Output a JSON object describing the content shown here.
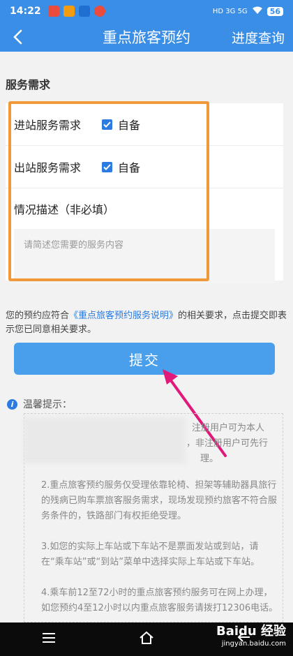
{
  "status_bar": {
    "time": "14:22",
    "network": "HD 3G 5G",
    "battery": "56"
  },
  "header": {
    "title": "重点旅客预约",
    "progress_link": "进度查询"
  },
  "service": {
    "section_title": "服务需求",
    "rows": [
      {
        "label": "进站服务需求",
        "option": "自备",
        "checked": true
      },
      {
        "label": "出站服务需求",
        "option": "自备",
        "checked": true
      }
    ],
    "description_label": "情况描述（非必填）",
    "description_placeholder": "请简述您需要的服务内容"
  },
  "agreement": {
    "prefix": "您的预约应符合",
    "link": "《重点旅客预约服务说明》",
    "suffix": "的相关要求，点击提交即表示您已同意相关要求。"
  },
  "submit_label": "提交",
  "tips": {
    "title": "温馨提示：",
    "partial_lines": [
      "注册用户可为本人",
      "，非注册用户可先行",
      "理。"
    ],
    "item2": "2.重点旅客预约服务仅受理依靠轮椅、担架等辅助器具旅行的残病已购车票旅客服务需求，现场发现预约旅客不符合服务条件的，铁路部门有权拒绝受理。",
    "item3": "3.如您的实际上车站或下车站不是票面发站或到站，请在“乘车站”或“到站”菜单中选择实际上车站或下车站。",
    "item4": "4.乘车前12至72小时的重点旅客预约服务可在网上办理，如您预约4至12小时以内重点旅客服务请拨打12306电话。"
  },
  "watermark": {
    "brand": "Baidu 经验",
    "site": "jingyan.baidu.com"
  },
  "colors": {
    "header": "#3a8ee6",
    "accent": "#2b7be0",
    "submit": "#4a9fec",
    "highlight": "#f0993a",
    "arrow": "#e0197a"
  }
}
